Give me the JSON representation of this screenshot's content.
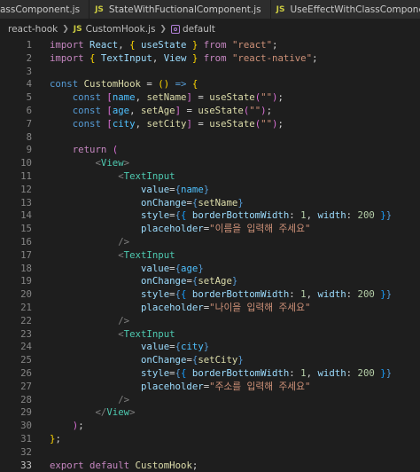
{
  "tabs": [
    {
      "label": "assComponent.js",
      "icon": ""
    },
    {
      "label": "StateWithFuctionalComponent.js",
      "icon": "JS"
    },
    {
      "label": "UseEffectWithClassComponent.js",
      "icon": "JS"
    }
  ],
  "breadcrumb": {
    "folder": "react-hook",
    "file_icon": "JS",
    "file": "CustomHook.js",
    "symbol": "default"
  },
  "code_lines": [
    {
      "n": "1"
    },
    {
      "n": "2"
    },
    {
      "n": "3"
    },
    {
      "n": "4"
    },
    {
      "n": "5"
    },
    {
      "n": "6"
    },
    {
      "n": "7"
    },
    {
      "n": "8"
    },
    {
      "n": "9"
    },
    {
      "n": "10"
    },
    {
      "n": "11"
    },
    {
      "n": "12"
    },
    {
      "n": "13"
    },
    {
      "n": "14"
    },
    {
      "n": "15"
    },
    {
      "n": "16"
    },
    {
      "n": "17"
    },
    {
      "n": "18"
    },
    {
      "n": "19"
    },
    {
      "n": "20"
    },
    {
      "n": "21"
    },
    {
      "n": "22"
    },
    {
      "n": "23"
    },
    {
      "n": "24"
    },
    {
      "n": "25"
    },
    {
      "n": "26"
    },
    {
      "n": "27"
    },
    {
      "n": "28"
    },
    {
      "n": "29"
    },
    {
      "n": "30"
    },
    {
      "n": "31"
    },
    {
      "n": "32"
    },
    {
      "n": "33"
    }
  ],
  "tokens": {
    "import": "import",
    "from": "from",
    "const": "const",
    "return": "return",
    "export": "export",
    "default": "default",
    "React": "React",
    "useState": "useState",
    "TextInput": "TextInput",
    "View": "View",
    "str_react": "\"react\"",
    "str_react_native": "\"react-native\"",
    "CustomHook": "CustomHook",
    "name": "name",
    "setName": "setName",
    "age": "age",
    "setAge": "setAge",
    "city": "city",
    "setCity": "setCity",
    "empty_str": "\"\"",
    "value": "value",
    "onChange": "onChange",
    "style": "style",
    "placeholder": "placeholder",
    "borderBottomWidth": "borderBottomWidth",
    "width": "width",
    "num1": "1",
    "num200": "200",
    "ph_name": "\"이름을 입력해 주세요\"",
    "ph_age": "\"나이을 입력해 주세요\"",
    "ph_city": "\"주소를 입력해 주세요\""
  },
  "colors": {
    "background": "#1e1e1e",
    "keyword": "#c586c0",
    "storage": "#569cd6",
    "variable": "#9cdcfe",
    "function": "#dcdcaa",
    "string": "#ce9178",
    "number": "#b5cea8",
    "tag": "#4ec9b0",
    "bracket_gold": "#ffd700",
    "bracket_orchid": "#da70d6",
    "bracket_blue": "#179fff"
  }
}
